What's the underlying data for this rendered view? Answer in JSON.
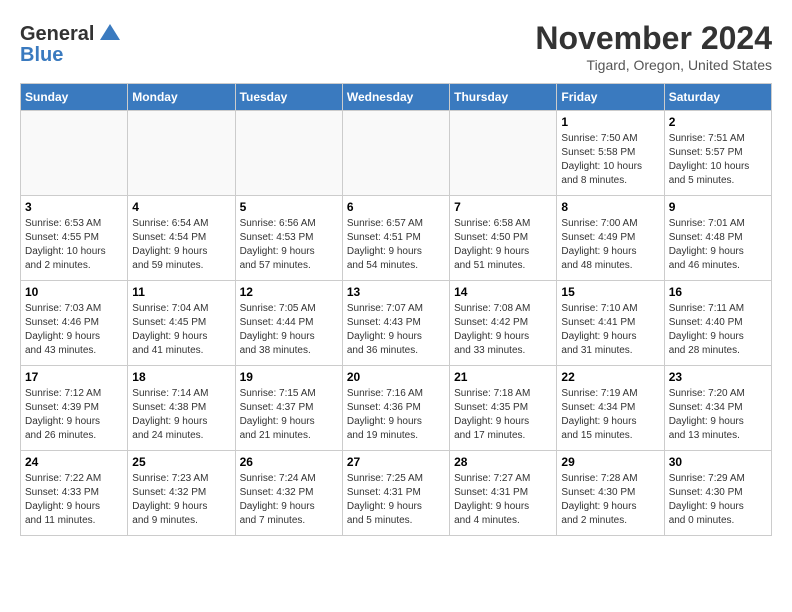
{
  "header": {
    "logo_line1": "General",
    "logo_line2": "Blue",
    "month_title": "November 2024",
    "location": "Tigard, Oregon, United States"
  },
  "weekdays": [
    "Sunday",
    "Monday",
    "Tuesday",
    "Wednesday",
    "Thursday",
    "Friday",
    "Saturday"
  ],
  "weeks": [
    [
      {
        "day": "",
        "info": ""
      },
      {
        "day": "",
        "info": ""
      },
      {
        "day": "",
        "info": ""
      },
      {
        "day": "",
        "info": ""
      },
      {
        "day": "",
        "info": ""
      },
      {
        "day": "1",
        "info": "Sunrise: 7:50 AM\nSunset: 5:58 PM\nDaylight: 10 hours\nand 8 minutes."
      },
      {
        "day": "2",
        "info": "Sunrise: 7:51 AM\nSunset: 5:57 PM\nDaylight: 10 hours\nand 5 minutes."
      }
    ],
    [
      {
        "day": "3",
        "info": "Sunrise: 6:53 AM\nSunset: 4:55 PM\nDaylight: 10 hours\nand 2 minutes."
      },
      {
        "day": "4",
        "info": "Sunrise: 6:54 AM\nSunset: 4:54 PM\nDaylight: 9 hours\nand 59 minutes."
      },
      {
        "day": "5",
        "info": "Sunrise: 6:56 AM\nSunset: 4:53 PM\nDaylight: 9 hours\nand 57 minutes."
      },
      {
        "day": "6",
        "info": "Sunrise: 6:57 AM\nSunset: 4:51 PM\nDaylight: 9 hours\nand 54 minutes."
      },
      {
        "day": "7",
        "info": "Sunrise: 6:58 AM\nSunset: 4:50 PM\nDaylight: 9 hours\nand 51 minutes."
      },
      {
        "day": "8",
        "info": "Sunrise: 7:00 AM\nSunset: 4:49 PM\nDaylight: 9 hours\nand 48 minutes."
      },
      {
        "day": "9",
        "info": "Sunrise: 7:01 AM\nSunset: 4:48 PM\nDaylight: 9 hours\nand 46 minutes."
      }
    ],
    [
      {
        "day": "10",
        "info": "Sunrise: 7:03 AM\nSunset: 4:46 PM\nDaylight: 9 hours\nand 43 minutes."
      },
      {
        "day": "11",
        "info": "Sunrise: 7:04 AM\nSunset: 4:45 PM\nDaylight: 9 hours\nand 41 minutes."
      },
      {
        "day": "12",
        "info": "Sunrise: 7:05 AM\nSunset: 4:44 PM\nDaylight: 9 hours\nand 38 minutes."
      },
      {
        "day": "13",
        "info": "Sunrise: 7:07 AM\nSunset: 4:43 PM\nDaylight: 9 hours\nand 36 minutes."
      },
      {
        "day": "14",
        "info": "Sunrise: 7:08 AM\nSunset: 4:42 PM\nDaylight: 9 hours\nand 33 minutes."
      },
      {
        "day": "15",
        "info": "Sunrise: 7:10 AM\nSunset: 4:41 PM\nDaylight: 9 hours\nand 31 minutes."
      },
      {
        "day": "16",
        "info": "Sunrise: 7:11 AM\nSunset: 4:40 PM\nDaylight: 9 hours\nand 28 minutes."
      }
    ],
    [
      {
        "day": "17",
        "info": "Sunrise: 7:12 AM\nSunset: 4:39 PM\nDaylight: 9 hours\nand 26 minutes."
      },
      {
        "day": "18",
        "info": "Sunrise: 7:14 AM\nSunset: 4:38 PM\nDaylight: 9 hours\nand 24 minutes."
      },
      {
        "day": "19",
        "info": "Sunrise: 7:15 AM\nSunset: 4:37 PM\nDaylight: 9 hours\nand 21 minutes."
      },
      {
        "day": "20",
        "info": "Sunrise: 7:16 AM\nSunset: 4:36 PM\nDaylight: 9 hours\nand 19 minutes."
      },
      {
        "day": "21",
        "info": "Sunrise: 7:18 AM\nSunset: 4:35 PM\nDaylight: 9 hours\nand 17 minutes."
      },
      {
        "day": "22",
        "info": "Sunrise: 7:19 AM\nSunset: 4:34 PM\nDaylight: 9 hours\nand 15 minutes."
      },
      {
        "day": "23",
        "info": "Sunrise: 7:20 AM\nSunset: 4:34 PM\nDaylight: 9 hours\nand 13 minutes."
      }
    ],
    [
      {
        "day": "24",
        "info": "Sunrise: 7:22 AM\nSunset: 4:33 PM\nDaylight: 9 hours\nand 11 minutes."
      },
      {
        "day": "25",
        "info": "Sunrise: 7:23 AM\nSunset: 4:32 PM\nDaylight: 9 hours\nand 9 minutes."
      },
      {
        "day": "26",
        "info": "Sunrise: 7:24 AM\nSunset: 4:32 PM\nDaylight: 9 hours\nand 7 minutes."
      },
      {
        "day": "27",
        "info": "Sunrise: 7:25 AM\nSunset: 4:31 PM\nDaylight: 9 hours\nand 5 minutes."
      },
      {
        "day": "28",
        "info": "Sunrise: 7:27 AM\nSunset: 4:31 PM\nDaylight: 9 hours\nand 4 minutes."
      },
      {
        "day": "29",
        "info": "Sunrise: 7:28 AM\nSunset: 4:30 PM\nDaylight: 9 hours\nand 2 minutes."
      },
      {
        "day": "30",
        "info": "Sunrise: 7:29 AM\nSunset: 4:30 PM\nDaylight: 9 hours\nand 0 minutes."
      }
    ]
  ]
}
